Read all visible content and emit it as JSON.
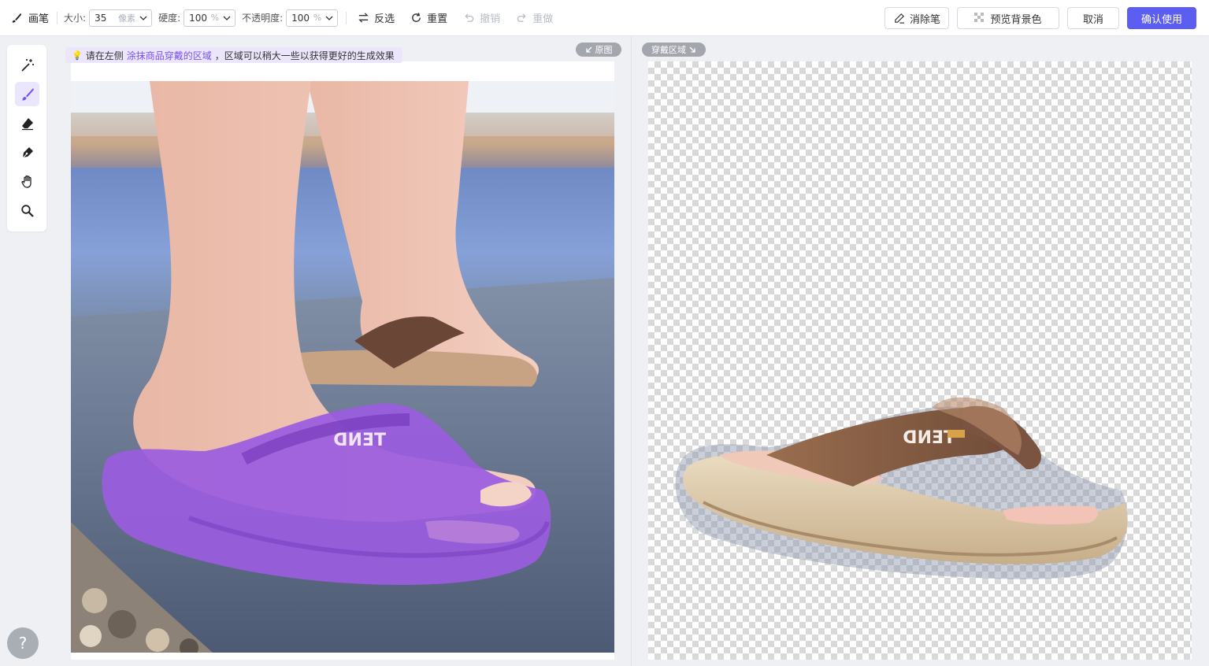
{
  "toolbar": {
    "tool_name": "画笔",
    "size_label": "大小:",
    "size_value": "35",
    "size_unit": "像素",
    "hardness_label": "硬度:",
    "hardness_value": "100",
    "hardness_unit": "%",
    "opacity_label": "不透明度:",
    "opacity_value": "100",
    "opacity_unit": "%",
    "invert_label": "反选",
    "reset_label": "重置",
    "undo_label": "撤销",
    "redo_label": "重做"
  },
  "actions": {
    "eraser_label": "消除笔",
    "preview_bg_label": "预览背景色",
    "cancel_label": "取消",
    "confirm_label": "确认使用"
  },
  "tools": [
    {
      "name": "magic-wand-icon",
      "active": false
    },
    {
      "name": "brush-icon",
      "active": true
    },
    {
      "name": "eraser-icon",
      "active": false
    },
    {
      "name": "pen-icon",
      "active": false
    },
    {
      "name": "hand-icon",
      "active": false
    },
    {
      "name": "zoom-icon",
      "active": false
    }
  ],
  "hint": {
    "prefix": "请在左侧",
    "highlight": "涂抹商品穿戴的区域",
    "suffix": "，区域可以稍大一些以获得更好的生成效果"
  },
  "left_panel": {
    "tag": "原图"
  },
  "right_panel": {
    "tag": "穿戴区域"
  },
  "help_label": "?",
  "colors": {
    "accent": "#5b5ef0",
    "mask_purple": "#9b5ce0",
    "hint_bg": "#ece6fd"
  }
}
